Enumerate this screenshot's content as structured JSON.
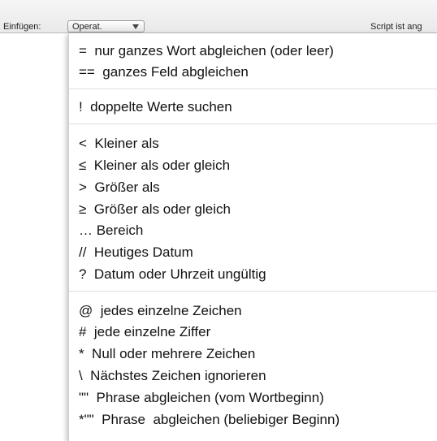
{
  "toolbar": {
    "insert_label": "Einfügen:",
    "operator_select": {
      "value": "Operat."
    },
    "status_text": "Script ist ang"
  },
  "menu": {
    "items": [
      "=  nur ganzes Wort abgleichen (oder leer)",
      "==  ganzes Feld abgleichen",
      "!  doppelte Werte suchen",
      "<  Kleiner als",
      "≤  Kleiner als oder gleich",
      ">  Größer als",
      "≥  Größer als oder gleich",
      "… Bereich",
      "//  Heutiges Datum",
      "?  Datum oder Uhrzeit ungültig",
      "@  jedes einzelne Zeichen",
      "#  jede einzelne Ziffer",
      "*  Null oder mehrere Zeichen",
      "\\  Nächstes Zeichen ignorieren",
      "\"\"  Phrase abgleichen (vom Wortbeginn)",
      "*\"\"  Phrase  abgleichen (beliebiger Beginn)"
    ]
  }
}
